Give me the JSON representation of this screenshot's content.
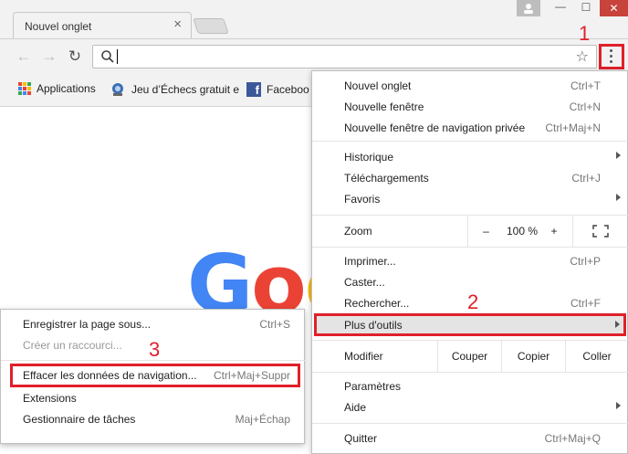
{
  "tab": {
    "title": "Nouvel onglet",
    "close": "×"
  },
  "window": {
    "min": "—",
    "max": "☐",
    "close": "✕"
  },
  "toolbar": {
    "back": "←",
    "forward": "→",
    "reload": "↻",
    "star": "☆"
  },
  "bookmarks": {
    "apps": "Applications",
    "chess": "Jeu d’Échecs gratuit e",
    "facebook": "Faceboo"
  },
  "google_partial": [
    "G",
    "o",
    "o"
  ],
  "colors": {
    "accent_red": "#e0202a",
    "g_blue": "#4285f4",
    "g_red": "#ea4335",
    "g_yellow": "#fbbc05"
  },
  "annotations": {
    "one": "1",
    "two": "2",
    "three": "3"
  },
  "menu": {
    "nouvel_onglet": {
      "label": "Nouvel onglet",
      "shortcut": "Ctrl+T"
    },
    "nouvelle_fenetre": {
      "label": "Nouvelle fenêtre",
      "shortcut": "Ctrl+N"
    },
    "navigation_privee": {
      "label": "Nouvelle fenêtre de navigation privée",
      "shortcut": "Ctrl+Maj+N"
    },
    "historique": {
      "label": "Historique"
    },
    "telechargements": {
      "label": "Téléchargements",
      "shortcut": "Ctrl+J"
    },
    "favoris": {
      "label": "Favoris"
    },
    "zoom": {
      "label": "Zoom",
      "minus": "–",
      "value": "100 %",
      "plus": "+"
    },
    "imprimer": {
      "label": "Imprimer...",
      "shortcut": "Ctrl+P"
    },
    "caster": {
      "label": "Caster..."
    },
    "rechercher": {
      "label": "Rechercher...",
      "shortcut": "Ctrl+F"
    },
    "plus_outils": {
      "label": "Plus d'outils"
    },
    "modifier": {
      "label": "Modifier",
      "couper": "Couper",
      "copier": "Copier",
      "coller": "Coller"
    },
    "parametres": {
      "label": "Paramètres"
    },
    "aide": {
      "label": "Aide"
    },
    "quitter": {
      "label": "Quitter",
      "shortcut": "Ctrl+Maj+Q"
    }
  },
  "submenu": {
    "enregistrer": {
      "label": "Enregistrer la page sous...",
      "shortcut": "Ctrl+S"
    },
    "raccourci": {
      "label": "Créer un raccourci..."
    },
    "effacer": {
      "label": "Effacer les données de navigation...",
      "shortcut": "Ctrl+Maj+Suppr"
    },
    "extensions": {
      "label": "Extensions"
    },
    "gestionnaire": {
      "label": "Gestionnaire de tâches",
      "shortcut": "Maj+Échap"
    }
  }
}
